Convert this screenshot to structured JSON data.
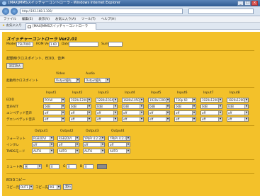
{
  "browser": {
    "title": "[MAX]MMSスイッチャーコントローラ - Windows Internet Explorer",
    "address": "http://192.168.1.100/",
    "menu": [
      "ファイル",
      "編集(E)",
      "表示(V)",
      "お気に入り(A)",
      "ツール(T)",
      "ヘルプ(H)"
    ],
    "favorites_label": "お気に入り",
    "tab_label": "[MAX]MMSスイッチャーコントローラ"
  },
  "app": {
    "title": "スイッチャーコントローラ Ver2.01",
    "model_label": "Model",
    "model_value": "TSU7000",
    "rom_label": "ROM Ver",
    "rom_value": "1.60",
    "date_label": "Date",
    "date_value": "",
    "sum_label": "Sum",
    "sum_value": ""
  },
  "crosspoint": {
    "section_label": "起動時クロスポイント、EDID、音声",
    "set_button": "設定読込",
    "video_label": "Video",
    "audio_label": "Audio",
    "row_label": "起動時クロスポイント",
    "video_value": "Output優先",
    "audio_value": "Output優先"
  },
  "edid": {
    "columns": [
      "Input1",
      "Input2",
      "Input3",
      "Input4",
      "Input5",
      "Input6",
      "Input7",
      "Input8"
    ],
    "rows": [
      {
        "label": "EDID",
        "values": [
          "PCfull",
          "1920x1200",
          "1280x1024",
          "1680x1050",
          "1920x1200",
          "720p 60",
          "1920x1200",
          "1920x1200"
        ]
      },
      {
        "label": "音声ATT",
        "values": [
          "0dB",
          "0dB",
          "0dB",
          "0dB",
          "0dB",
          "0dB",
          "0dB",
          "0dB"
        ]
      },
      {
        "label": "エンベデッド音声",
        "values": [
          "off",
          "off",
          "off",
          "off",
          "off",
          "off",
          "off",
          "off"
        ]
      },
      {
        "label": "デエンベデッド音声",
        "values": [
          "off",
          "off",
          "off",
          "off",
          "off",
          "off",
          "off",
          "off"
        ]
      }
    ]
  },
  "outputs": {
    "columns": [
      "Output1",
      "Output2",
      "Output3",
      "Output4"
    ],
    "rows": [
      {
        "label": "フォーマット",
        "values": [
          "RGB2DVI",
          "RGB2DVI",
          "YPbPr 4:2:2",
          "YPbPr 4:2:2"
        ]
      },
      {
        "label": "インタレ",
        "values": [
          "off",
          "off",
          "off",
          "off"
        ]
      },
      {
        "label": "TMDSモード",
        "values": [
          "AUTO",
          "AUTO",
          "AUTO",
          "AUTO"
        ]
      }
    ]
  },
  "timer": {
    "label": "ミュート色",
    "select_value": "黒",
    "r_label": "R",
    "r_value": "0",
    "g_label": "G",
    "g_value": "0",
    "b_label": "B",
    "b_value": "0"
  },
  "copy": {
    "section_label": "EDIDコピー",
    "from_label": "コピー元",
    "from_value": "OUT1",
    "to_label": "コピー先",
    "to_value": "IN1",
    "button": "実行"
  },
  "colors": {
    "background": "#f3c12a",
    "titlebar": "#2e5a92",
    "field": "#ffffff"
  }
}
